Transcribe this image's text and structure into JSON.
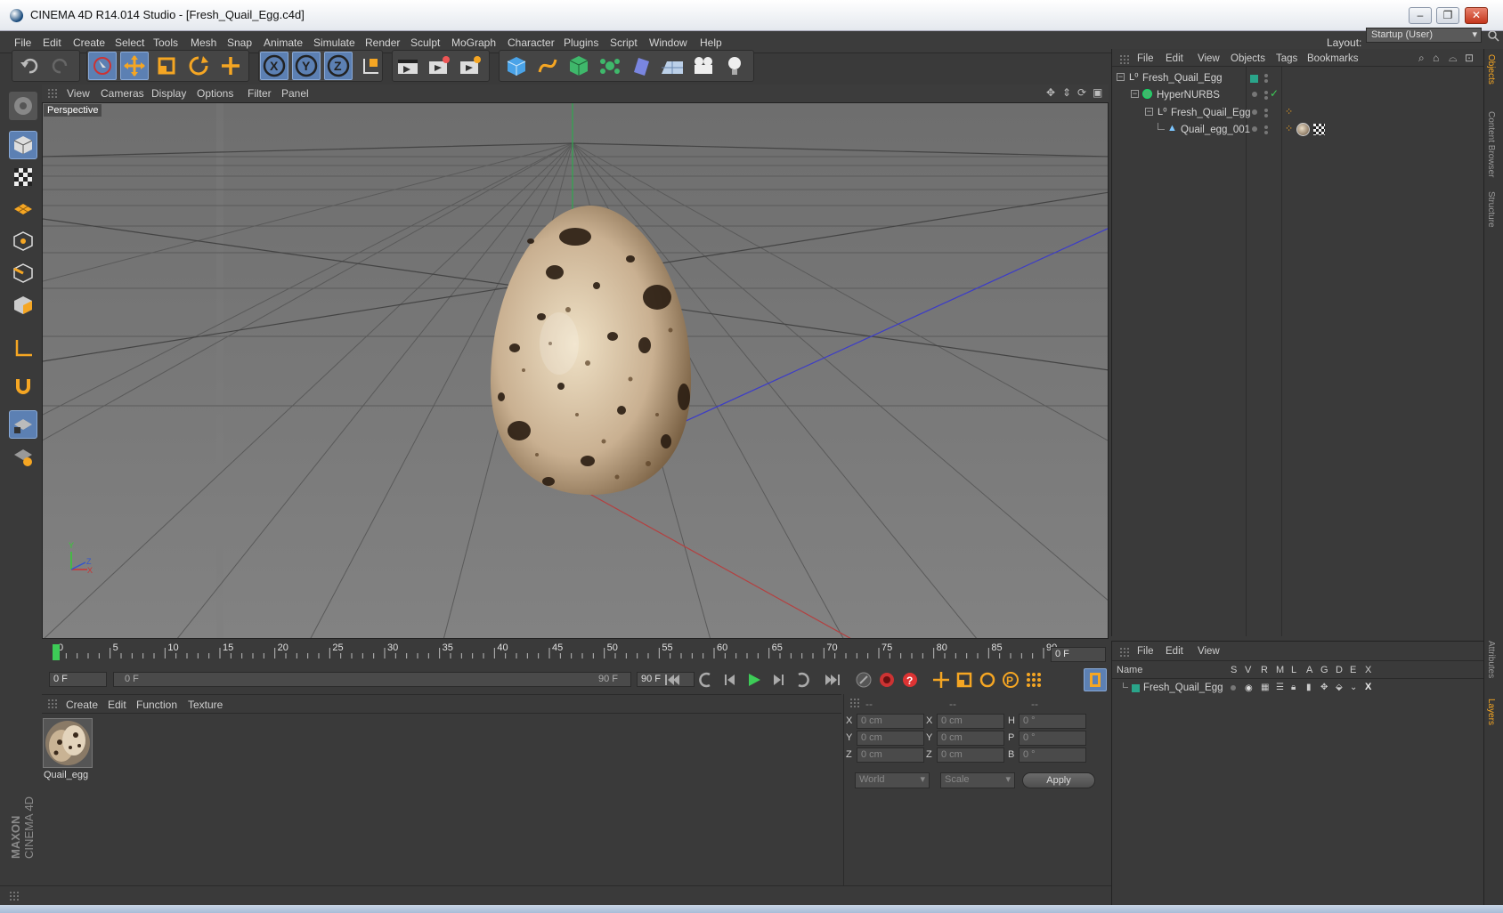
{
  "app": {
    "title": "CINEMA 4D R14.014 Studio - [Fresh_Quail_Egg.c4d]",
    "layout_label": "Layout:",
    "layout_value": "Startup (User)",
    "accent_color": "#5c80b3"
  },
  "menu": [
    "File",
    "Edit",
    "Create",
    "Select",
    "Tools",
    "Mesh",
    "Snap",
    "Animate",
    "Simulate",
    "Render",
    "Sculpt",
    "MoGraph",
    "Character",
    "Plugins",
    "Script",
    "Window",
    "Help"
  ],
  "viewport": {
    "menu": [
      "View",
      "Cameras",
      "Display",
      "Options",
      "Filter",
      "Panel"
    ],
    "camera_label": "Perspective",
    "axis_labels": {
      "y": "Y",
      "z": "Z",
      "x": "X"
    }
  },
  "timeline": {
    "ticks": [
      "0",
      "5",
      "10",
      "15",
      "20",
      "25",
      "30",
      "35",
      "40",
      "45",
      "50",
      "55",
      "60",
      "65",
      "70",
      "75",
      "80",
      "85",
      "90"
    ],
    "end_field": "0 F",
    "start_field": "0 F",
    "range_start": "0 F",
    "range_end": "90 F",
    "max_field": "90 F"
  },
  "material_panel": {
    "menu": [
      "Create",
      "Edit",
      "Function",
      "Texture"
    ],
    "material_name": "Quail_egg"
  },
  "coord_panel": {
    "headers": [
      "--",
      "--",
      "--"
    ],
    "rows": [
      {
        "a": "X",
        "av": "0 cm",
        "b": "X",
        "bv": "0 cm",
        "c": "H",
        "cv": "0 °"
      },
      {
        "a": "Y",
        "av": "0 cm",
        "b": "Y",
        "bv": "0 cm",
        "c": "P",
        "cv": "0 °"
      },
      {
        "a": "Z",
        "av": "0 cm",
        "b": "Z",
        "bv": "0 cm",
        "c": "B",
        "cv": "0 °"
      }
    ],
    "space_select": "World",
    "mode_select": "Scale",
    "apply_label": "Apply"
  },
  "object_manager": {
    "menu": [
      "File",
      "Edit",
      "View",
      "Objects",
      "Tags",
      "Bookmarks"
    ],
    "objects": [
      {
        "name": "Fresh_Quail_Egg",
        "indent": 0,
        "type": "null"
      },
      {
        "name": "HyperNURBS",
        "indent": 1,
        "type": "nurbs"
      },
      {
        "name": "Fresh_Quail_Egg",
        "indent": 2,
        "type": "null"
      },
      {
        "name": "Quail_egg_001",
        "indent": 3,
        "type": "mesh"
      }
    ]
  },
  "layer_manager": {
    "menu": [
      "File",
      "Edit",
      "View"
    ],
    "columns": [
      "Name",
      "S",
      "V",
      "R",
      "M",
      "L",
      "A",
      "G",
      "D",
      "E",
      "X"
    ],
    "layers": [
      {
        "name": "Fresh_Quail_Egg",
        "color": "#2aa58a"
      }
    ]
  },
  "side_tabs": [
    "Objects",
    "Content Browser",
    "Structure",
    "Attributes",
    "Layers"
  ],
  "brand": {
    "line1": "MAXON",
    "line2": "CINEMA 4D"
  }
}
